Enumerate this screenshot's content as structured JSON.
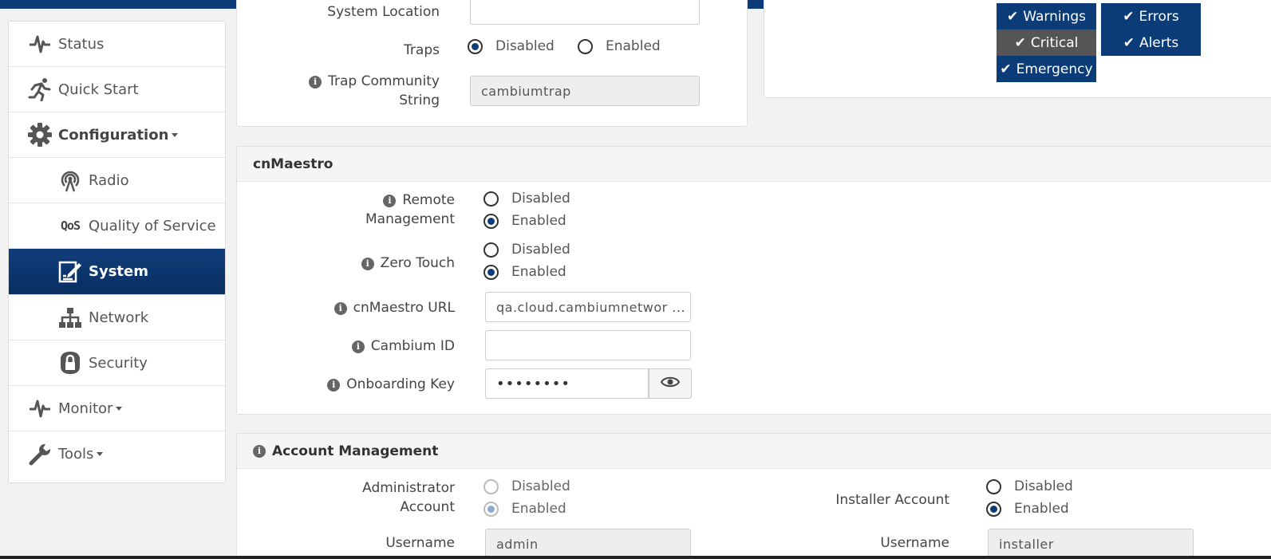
{
  "sidebar": {
    "items": [
      {
        "label": "Status",
        "icon": "pulse-icon"
      },
      {
        "label": "Quick Start",
        "icon": "runner-icon"
      },
      {
        "label": "Configuration",
        "icon": "gear-icon"
      },
      {
        "label": "Radio",
        "icon": "antenna-icon"
      },
      {
        "label": "Quality of Service",
        "icon": "qos-icon"
      },
      {
        "label": "System",
        "icon": "edit-icon"
      },
      {
        "label": "Network",
        "icon": "network-icon"
      },
      {
        "label": "Security",
        "icon": "lock-icon"
      },
      {
        "label": "Monitor",
        "icon": "pulse-icon"
      },
      {
        "label": "Tools",
        "icon": "wrench-icon"
      }
    ],
    "qos_glyph": "QoS"
  },
  "snmp": {
    "system_location_label": "System Location",
    "traps_label": "Traps",
    "traps_disabled": "Disabled",
    "traps_enabled": "Enabled",
    "trap_community_label_1": "Trap Community",
    "trap_community_label_2": "String",
    "trap_community_value": "cambiumtrap"
  },
  "log_levels": {
    "warnings": "Warnings",
    "errors": "Errors",
    "critical": "Critical",
    "alerts": "Alerts",
    "emergency": "Emergency"
  },
  "cnmaestro": {
    "title": "cnMaestro",
    "remote_label_1": "Remote",
    "remote_label_2": "Management",
    "zero_touch_label": "Zero Touch",
    "disabled": "Disabled",
    "enabled": "Enabled",
    "url_label": "cnMaestro URL",
    "url_value": "qa.cloud.cambiumnetwor ...",
    "cambium_id_label": "Cambium ID",
    "cambium_id_value": "",
    "onboarding_label": "Onboarding Key",
    "onboarding_value": "••••••••"
  },
  "account": {
    "title": "Account Management",
    "admin_label_1": "Administrator",
    "admin_label_2": "Account",
    "installer_label": "Installer Account",
    "disabled": "Disabled",
    "enabled": "Enabled",
    "username_label": "Username",
    "admin_username": "admin",
    "installer_username": "installer"
  },
  "colors": {
    "brand": "#0b3c78",
    "badge_grey": "#555555"
  }
}
